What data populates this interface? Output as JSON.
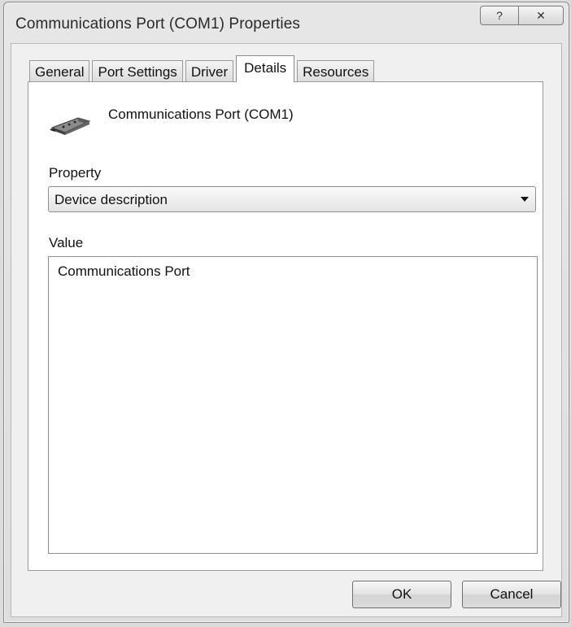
{
  "window": {
    "title": "Communications Port (COM1) Properties",
    "help_button": "?",
    "close_button": "✕"
  },
  "tabs": [
    {
      "label": "General",
      "active": false
    },
    {
      "label": "Port Settings",
      "active": false
    },
    {
      "label": "Driver",
      "active": false
    },
    {
      "label": "Details",
      "active": true
    },
    {
      "label": "Resources",
      "active": false
    }
  ],
  "details": {
    "device_name": "Communications Port (COM1)",
    "device_icon": "serial-port-connector-icon",
    "property_label": "Property",
    "property_selected": "Device description",
    "value_label": "Value",
    "values": [
      "Communications Port"
    ]
  },
  "buttons": {
    "ok": "OK",
    "cancel": "Cancel"
  }
}
